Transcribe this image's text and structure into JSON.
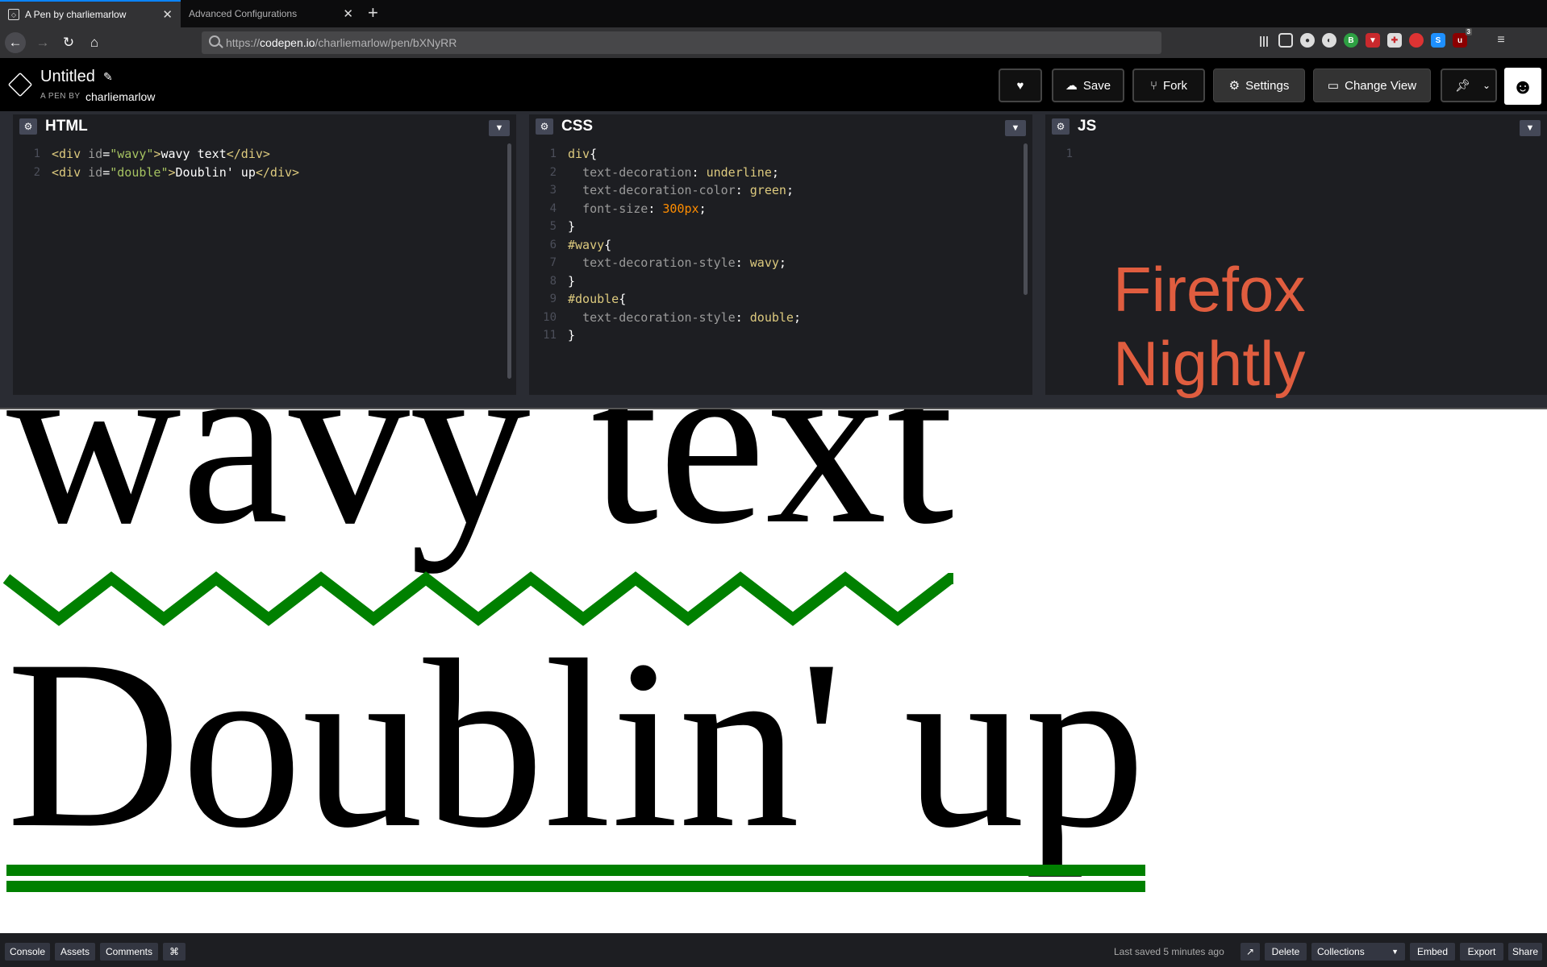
{
  "browser": {
    "tabs": [
      {
        "title": "A Pen by charliemarlow",
        "active": true
      },
      {
        "title": "Advanced Configurations",
        "active": false
      }
    ],
    "url": {
      "scheme": "https://",
      "host": "codepen.io",
      "path": "/charliemarlow/pen/bXNyRR"
    },
    "extension_badge": "3"
  },
  "header": {
    "title": "Untitled",
    "by_label": "A PEN BY",
    "author": "charliemarlow",
    "buttons": {
      "save": "Save",
      "fork": "Fork",
      "settings": "Settings",
      "change_view": "Change View"
    }
  },
  "editors": {
    "html": {
      "title": "HTML",
      "lines": [
        {
          "n": "1",
          "id": "wavy",
          "text": "wavy text"
        },
        {
          "n": "2",
          "id": "double",
          "text": "Doublin' up"
        }
      ]
    },
    "css": {
      "title": "CSS",
      "line_numbers": [
        "1",
        "2",
        "3",
        "4",
        "5",
        "6",
        "7",
        "8",
        "9",
        "10",
        "11"
      ],
      "rules": [
        {
          "selector": "div",
          "decls": [
            {
              "prop": "text-decoration",
              "val": "underline"
            },
            {
              "prop": "text-decoration-color",
              "val": "green"
            },
            {
              "prop": "font-size",
              "val": "300px"
            }
          ]
        },
        {
          "selector": "#wavy",
          "decls": [
            {
              "prop": "text-decoration-style",
              "val": "wavy"
            }
          ]
        },
        {
          "selector": "#double",
          "decls": [
            {
              "prop": "text-decoration-style",
              "val": "double"
            }
          ]
        }
      ]
    },
    "js": {
      "title": "JS",
      "line_numbers": [
        "1"
      ],
      "watermark": [
        "Firefox",
        "Nightly"
      ]
    }
  },
  "preview": {
    "wavy_text": "wavy text",
    "double_text": "Doublin' up",
    "decoration_color": "#008000"
  },
  "bottom_bar": {
    "console": "Console",
    "assets": "Assets",
    "comments": "Comments",
    "shortcut_icon": "⌘",
    "last_saved": "Last saved 5 minutes ago",
    "delete": "Delete",
    "collections": "Collections",
    "embed": "Embed",
    "export": "Export",
    "share": "Share"
  },
  "colors": {
    "accent": "#0a84ff",
    "watermark": "#e05d3f",
    "underline": "#008000"
  }
}
